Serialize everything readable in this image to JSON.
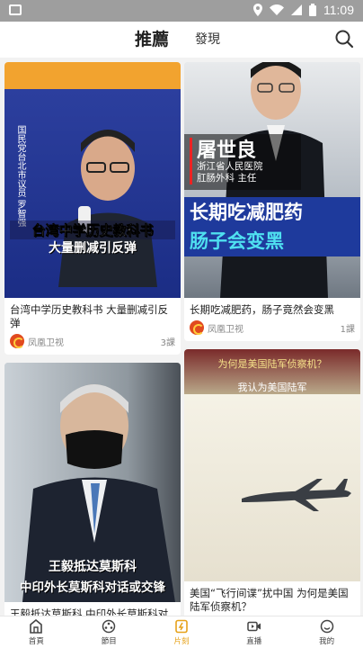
{
  "status_bar": {
    "time": "11:09"
  },
  "header": {
    "tab_recommend": "推薦",
    "tab_discover": "發現"
  },
  "cards": [
    {
      "title": "台湾中学历史教科书 大量删减引反弹",
      "thumb_vertical_text": "国民党台北市议员 罗智强",
      "thumb_caption_1": "台湾中学历史教科书",
      "thumb_caption_2": "大量删减引反弹",
      "source": "凤凰卫视",
      "count": "3課"
    },
    {
      "title": "长期吃减肥药，肠子竟然会变黑",
      "thumb_name": "屠世良",
      "thumb_org_1": "浙江省人民医院",
      "thumb_org_2": "肛肠外科 主任",
      "thumb_big_1": "长期吃减肥药",
      "thumb_big_2": "肠子会变黑",
      "source": "凤凰卫视",
      "count": "1課"
    },
    {
      "title": "王毅抵达莫斯科 中印外长莫斯科对话或交锋",
      "thumb_caption_1": "王毅抵达莫斯科",
      "thumb_caption_2": "中印外长莫斯科对话或交锋"
    },
    {
      "title": "美国“飞行间谍”扰中国 为何是美国陆军侦察机？",
      "thumb_line_1": "为何是美国陆军侦察机？",
      "thumb_line_2": "我认为美国陆军"
    }
  ],
  "bottom_nav": [
    {
      "label": "首頁",
      "icon": "home-icon"
    },
    {
      "label": "節目",
      "icon": "program-icon"
    },
    {
      "label": "片刻",
      "icon": "moment-icon",
      "active": true
    },
    {
      "label": "直播",
      "icon": "live-icon"
    },
    {
      "label": "我的",
      "icon": "profile-icon"
    }
  ],
  "colors": {
    "accent": "#e6a21a",
    "source_logo": "#e14a1f"
  }
}
